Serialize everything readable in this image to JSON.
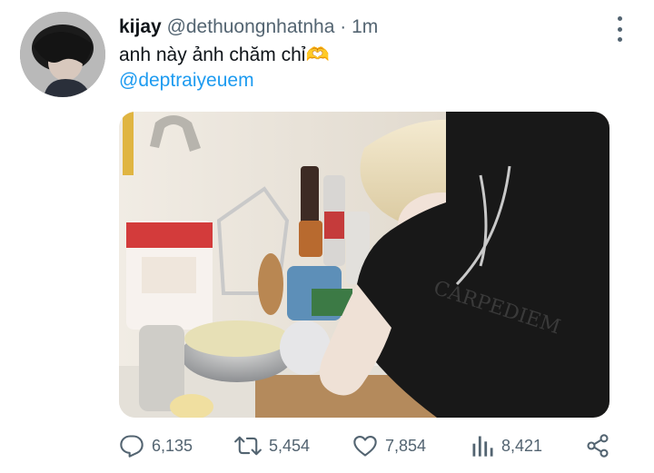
{
  "tweet": {
    "display_name": "kijay",
    "handle": "@dethuongnhatnha",
    "separator": "·",
    "time": "1m",
    "text": "anh này ảnh chăm chỉ🫶",
    "mention": "@deptraiyeuem"
  },
  "icons": {
    "more": "more-vertical-icon",
    "reply": "reply-icon",
    "retweet": "retweet-icon",
    "like": "heart-icon",
    "views": "bar-chart-icon",
    "share": "share-icon"
  },
  "actions": {
    "replies": "6,135",
    "retweets": "5,454",
    "likes": "7,854",
    "views": "8,421"
  },
  "colors": {
    "link": "#1d9bf0",
    "secondary_text": "#536471",
    "primary_text": "#0f1419"
  }
}
